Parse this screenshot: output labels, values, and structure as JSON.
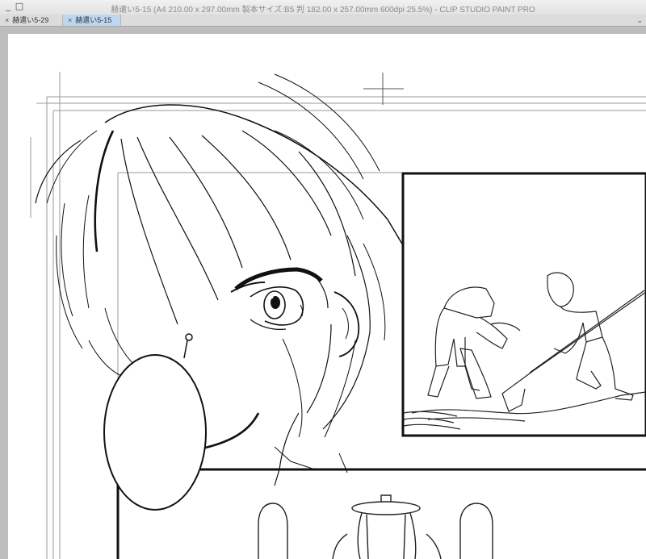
{
  "window": {
    "title": "赫遣い5-15 (A4 210.00 x 297.00mm 製本サイズ:B5 判 182.00 x 257.00mm 600dpi 25.5%) - CLIP STUDIO PAINT PRO",
    "minimize_label": "_",
    "maximize_label": "□"
  },
  "tabs": [
    {
      "label": "赫遣い5-29",
      "close": "×",
      "active": false
    },
    {
      "label": "赫遣い5-15",
      "close": "×",
      "active": true
    }
  ],
  "tab_menu_label": "⌄",
  "colors": {
    "titlebar": "#e8e8e8",
    "tab_active": "#bcd7ef",
    "canvas_bg": "#bdbdbd",
    "paper": "#ffffff",
    "ink": "#111111"
  }
}
